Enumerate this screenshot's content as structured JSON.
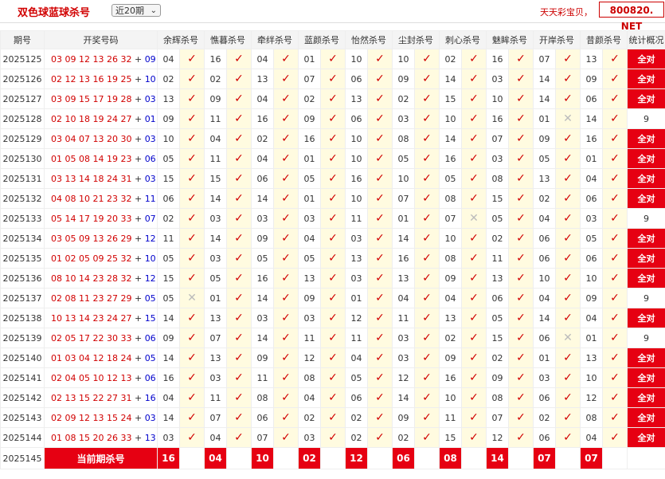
{
  "header": {
    "title": "双色球蓝球杀号",
    "range_select": "近20期",
    "brand_text": "天天彩宝贝，",
    "site_text": "800820. NET"
  },
  "columns": [
    "期号",
    "开奖号码",
    "余辉杀号",
    "憔暮杀号",
    "牵绊杀号",
    "蓝颜杀号",
    "怡然杀号",
    "尘封杀号",
    "刺心杀号",
    "魅眸杀号",
    "开岸杀号",
    "昔颜杀号",
    "统计概况"
  ],
  "rows": [
    {
      "period": "2025125",
      "red": "03 09 12 13 26 32",
      "blue": "09",
      "kills": [
        "04",
        "16",
        "04",
        "01",
        "10",
        "10",
        "02",
        "16",
        "07",
        "13"
      ],
      "res": [
        1,
        1,
        1,
        1,
        1,
        1,
        1,
        1,
        1,
        1
      ],
      "summary": "全对"
    },
    {
      "period": "2025126",
      "red": "02 12 13 16 19 25",
      "blue": "10",
      "kills": [
        "02",
        "02",
        "13",
        "07",
        "06",
        "09",
        "14",
        "03",
        "14",
        "09"
      ],
      "res": [
        1,
        1,
        1,
        1,
        1,
        1,
        1,
        1,
        1,
        1
      ],
      "summary": "全对"
    },
    {
      "period": "2025127",
      "red": "03 09 15 17 19 28",
      "blue": "03",
      "kills": [
        "13",
        "09",
        "04",
        "02",
        "13",
        "02",
        "15",
        "10",
        "14",
        "06"
      ],
      "res": [
        1,
        1,
        1,
        1,
        1,
        1,
        1,
        1,
        1,
        1
      ],
      "summary": "全对"
    },
    {
      "period": "2025128",
      "red": "02 10 18 19 24 27",
      "blue": "01",
      "kills": [
        "09",
        "11",
        "16",
        "09",
        "06",
        "03",
        "10",
        "16",
        "01",
        "14"
      ],
      "res": [
        1,
        1,
        1,
        1,
        1,
        1,
        1,
        1,
        0,
        1
      ],
      "summary": "9"
    },
    {
      "period": "2025129",
      "red": "03 04 07 13 20 30",
      "blue": "03",
      "kills": [
        "10",
        "04",
        "02",
        "16",
        "10",
        "08",
        "14",
        "07",
        "09",
        "16"
      ],
      "res": [
        1,
        1,
        1,
        1,
        1,
        1,
        1,
        1,
        1,
        1
      ],
      "summary": "全对"
    },
    {
      "period": "2025130",
      "red": "01 05 08 14 19 23",
      "blue": "06",
      "kills": [
        "05",
        "11",
        "04",
        "01",
        "10",
        "05",
        "16",
        "03",
        "05",
        "01"
      ],
      "res": [
        1,
        1,
        1,
        1,
        1,
        1,
        1,
        1,
        1,
        1
      ],
      "summary": "全对"
    },
    {
      "period": "2025131",
      "red": "03 13 14 18 24 31",
      "blue": "03",
      "kills": [
        "15",
        "15",
        "06",
        "05",
        "16",
        "10",
        "05",
        "08",
        "13",
        "04"
      ],
      "res": [
        1,
        1,
        1,
        1,
        1,
        1,
        1,
        1,
        1,
        1
      ],
      "summary": "全对"
    },
    {
      "period": "2025132",
      "red": "04 08 10 21 23 32",
      "blue": "11",
      "kills": [
        "06",
        "14",
        "14",
        "01",
        "10",
        "07",
        "08",
        "15",
        "02",
        "06"
      ],
      "res": [
        1,
        1,
        1,
        1,
        1,
        1,
        1,
        1,
        1,
        1
      ],
      "summary": "全对"
    },
    {
      "period": "2025133",
      "red": "05 14 17 19 20 33",
      "blue": "07",
      "kills": [
        "02",
        "03",
        "03",
        "03",
        "11",
        "01",
        "07",
        "05",
        "04",
        "03"
      ],
      "res": [
        1,
        1,
        1,
        1,
        1,
        1,
        0,
        1,
        1,
        1
      ],
      "summary": "9"
    },
    {
      "period": "2025134",
      "red": "03 05 09 13 26 29",
      "blue": "12",
      "kills": [
        "11",
        "14",
        "09",
        "04",
        "03",
        "14",
        "10",
        "02",
        "06",
        "05"
      ],
      "res": [
        1,
        1,
        1,
        1,
        1,
        1,
        1,
        1,
        1,
        1
      ],
      "summary": "全对"
    },
    {
      "period": "2025135",
      "red": "01 02 05 09 25 32",
      "blue": "10",
      "kills": [
        "05",
        "03",
        "05",
        "05",
        "13",
        "16",
        "08",
        "11",
        "06",
        "06"
      ],
      "res": [
        1,
        1,
        1,
        1,
        1,
        1,
        1,
        1,
        1,
        1
      ],
      "summary": "全对"
    },
    {
      "period": "2025136",
      "red": "08 10 14 23 28 32",
      "blue": "12",
      "kills": [
        "15",
        "05",
        "16",
        "13",
        "03",
        "13",
        "09",
        "13",
        "10",
        "10"
      ],
      "res": [
        1,
        1,
        1,
        1,
        1,
        1,
        1,
        1,
        1,
        1
      ],
      "summary": "全对"
    },
    {
      "period": "2025137",
      "red": "02 08 11 23 27 29",
      "blue": "05",
      "kills": [
        "05",
        "01",
        "14",
        "09",
        "01",
        "04",
        "04",
        "06",
        "04",
        "09"
      ],
      "res": [
        0,
        1,
        1,
        1,
        1,
        1,
        1,
        1,
        1,
        1
      ],
      "summary": "9"
    },
    {
      "period": "2025138",
      "red": "10 13 14 23 24 27",
      "blue": "15",
      "kills": [
        "14",
        "13",
        "03",
        "03",
        "12",
        "11",
        "13",
        "05",
        "14",
        "04"
      ],
      "res": [
        1,
        1,
        1,
        1,
        1,
        1,
        1,
        1,
        1,
        1
      ],
      "summary": "全对"
    },
    {
      "period": "2025139",
      "red": "02 05 17 22 30 33",
      "blue": "06",
      "kills": [
        "09",
        "07",
        "14",
        "11",
        "11",
        "03",
        "02",
        "15",
        "06",
        "01"
      ],
      "res": [
        1,
        1,
        1,
        1,
        1,
        1,
        1,
        1,
        0,
        1
      ],
      "summary": "9"
    },
    {
      "period": "2025140",
      "red": "01 03 04 12 18 24",
      "blue": "05",
      "kills": [
        "14",
        "13",
        "09",
        "12",
        "04",
        "03",
        "09",
        "02",
        "01",
        "13"
      ],
      "res": [
        1,
        1,
        1,
        1,
        1,
        1,
        1,
        1,
        1,
        1
      ],
      "summary": "全对"
    },
    {
      "period": "2025141",
      "red": "02 04 05 10 12 13",
      "blue": "06",
      "kills": [
        "16",
        "03",
        "11",
        "08",
        "05",
        "12",
        "16",
        "09",
        "03",
        "10"
      ],
      "res": [
        1,
        1,
        1,
        1,
        1,
        1,
        1,
        1,
        1,
        1
      ],
      "summary": "全对"
    },
    {
      "period": "2025142",
      "red": "02 13 15 22 27 31",
      "blue": "16",
      "kills": [
        "04",
        "11",
        "08",
        "04",
        "06",
        "14",
        "10",
        "08",
        "06",
        "12"
      ],
      "res": [
        1,
        1,
        1,
        1,
        1,
        1,
        1,
        1,
        1,
        1
      ],
      "summary": "全对"
    },
    {
      "period": "2025143",
      "red": "02 09 12 13 15 24",
      "blue": "03",
      "kills": [
        "14",
        "07",
        "06",
        "02",
        "02",
        "09",
        "11",
        "07",
        "02",
        "08"
      ],
      "res": [
        1,
        1,
        1,
        1,
        1,
        1,
        1,
        1,
        1,
        1
      ],
      "summary": "全对"
    },
    {
      "period": "2025144",
      "red": "01 08 15 20 26 33",
      "blue": "13",
      "kills": [
        "03",
        "04",
        "07",
        "03",
        "02",
        "02",
        "15",
        "12",
        "06",
        "04"
      ],
      "res": [
        1,
        1,
        1,
        1,
        1,
        1,
        1,
        1,
        1,
        1
      ],
      "summary": "全对"
    }
  ],
  "current": {
    "period": "2025145",
    "label": "当前期杀号",
    "kills": [
      "16",
      "04",
      "10",
      "02",
      "12",
      "06",
      "08",
      "14",
      "07",
      "07"
    ]
  },
  "marks": {
    "ok": "✓",
    "bad": "✕"
  }
}
